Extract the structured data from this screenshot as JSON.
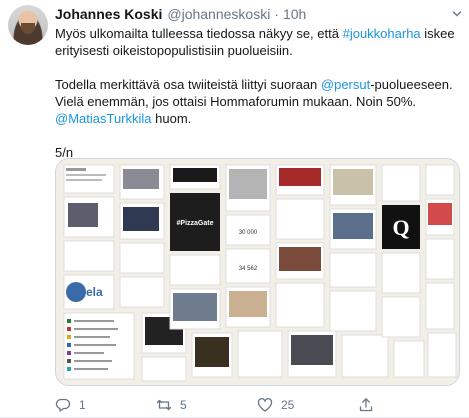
{
  "tweet": {
    "author_name": "Johannes Koski",
    "author_handle": "@johanneskoski",
    "separator": "·",
    "time": "10h",
    "paragraph1": {
      "before": "Myös ulkomailta tulleessa tiedossa näkyy se, että ",
      "hashtag": "#joukkoharha",
      "after": " iskee erityisesti oikeistopopulistisiin puolueisiin."
    },
    "paragraph2": {
      "before": "Todella merkittävä osa twiiteistä liittyi suoraan ",
      "mention1": "@persut",
      "middle": "-puolueeseen. Vielä enemmän, jos ottaisi Hommaforumin mukaan. Noin 50%. ",
      "mention2": "@MatiasTurkkila",
      "after": " huom."
    },
    "paragraph3": "5/n"
  },
  "media": {
    "collage_labels": {
      "pizzagate": "#PizzaGate",
      "q_letter": "Q",
      "number1": "30 000",
      "number2": "34 562",
      "brand": "ela"
    }
  },
  "actions": {
    "reply_count": "1",
    "retweet_count": "5",
    "like_count": "25",
    "reply_icon": "reply-icon",
    "retweet_icon": "retweet-icon",
    "like_icon": "heart-icon",
    "share_icon": "share-icon"
  },
  "colors": {
    "link": "#1b95e0",
    "secondary_text": "#657786",
    "border": "#ccd6dd"
  }
}
